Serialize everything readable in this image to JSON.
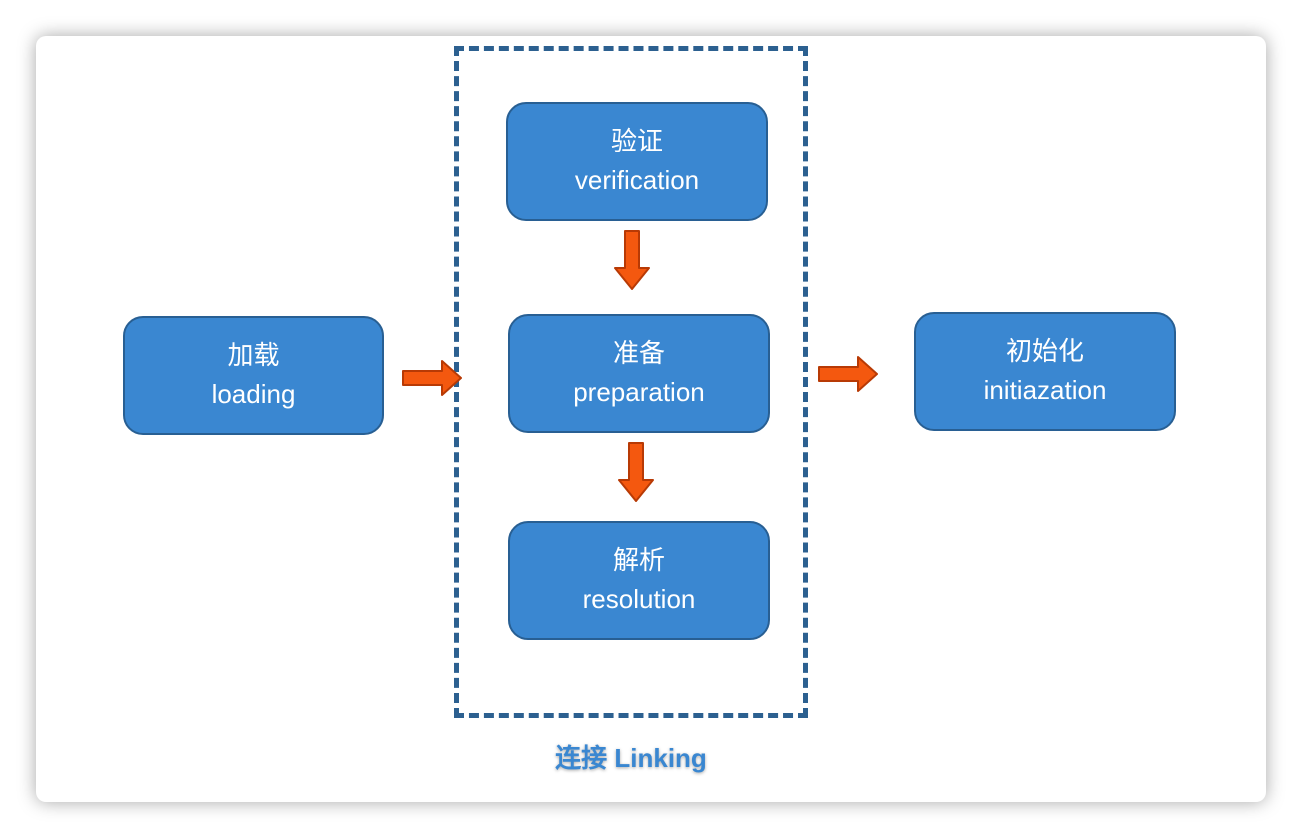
{
  "colors": {
    "node_fill": "#3a87d1",
    "node_border": "#285f93",
    "arrow_fill": "#f4580f",
    "arrow_stroke": "#b83a05",
    "group_border": "#2c6090",
    "group_label": "#3a87d1"
  },
  "nodes": {
    "loading": {
      "zh": "加载",
      "en": "loading"
    },
    "verification": {
      "zh": "验证",
      "en": "verification"
    },
    "preparation": {
      "zh": "准备",
      "en": "preparation"
    },
    "resolution": {
      "zh": "解析",
      "en": "resolution"
    },
    "initialization": {
      "zh": "初始化",
      "en": "initiazation"
    }
  },
  "group": {
    "label": "连接 Linking"
  }
}
